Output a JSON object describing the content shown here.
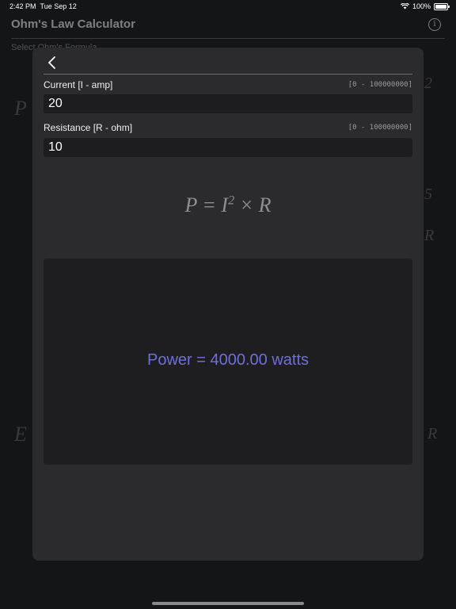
{
  "status_bar": {
    "time": "2:42 PM",
    "date": "Tue Sep 12",
    "battery": "100%"
  },
  "background_app": {
    "title": "Ohm's Law Calculator",
    "subtitle": "Select Ohm's Formula",
    "formula_left_top": "P",
    "formula_left_bottom": "E",
    "formula_right_top": "2",
    "formula_right_mid": "5",
    "formula_right_mid2": "R",
    "formula_right_bottom": "R"
  },
  "inputs": {
    "current": {
      "label": "Current [I - amp]",
      "range": "[0 - 100000000]",
      "value": "20"
    },
    "resistance": {
      "label": "Resistance [R - ohm]",
      "range": "[0 - 100000000]",
      "value": "10"
    }
  },
  "formula": {
    "lhs": "P = I",
    "exponent": "2",
    "rhs": " × R"
  },
  "result": {
    "text": "Power = 4000.00 watts"
  },
  "colors": {
    "result_text": "#6f6fd8",
    "sheet_bg": "#2b2b2d"
  }
}
